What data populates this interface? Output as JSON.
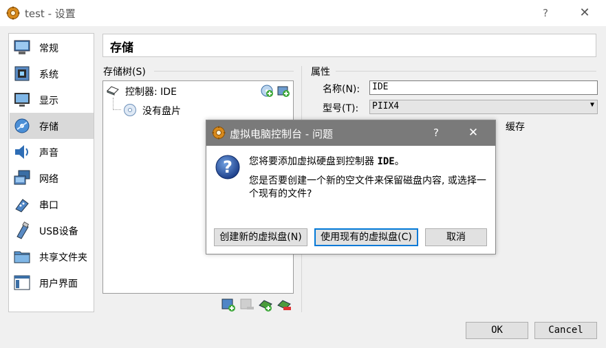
{
  "window": {
    "title": "test - 设置",
    "help_glyph": "?",
    "close_glyph": "✕"
  },
  "nav": {
    "items": [
      {
        "label": "常规",
        "icon": "general-icon"
      },
      {
        "label": "系统",
        "icon": "system-icon"
      },
      {
        "label": "显示",
        "icon": "display-icon"
      },
      {
        "label": "存储",
        "icon": "storage-icon",
        "selected": true
      },
      {
        "label": "声音",
        "icon": "audio-icon"
      },
      {
        "label": "网络",
        "icon": "network-icon"
      },
      {
        "label": "串口",
        "icon": "serial-port-icon"
      },
      {
        "label": "USB设备",
        "icon": "usb-icon"
      },
      {
        "label": "共享文件夹",
        "icon": "shared-folder-icon"
      },
      {
        "label": "用户界面",
        "icon": "user-interface-icon"
      }
    ]
  },
  "page": {
    "title": "存储"
  },
  "storage_tree": {
    "label": "存储树(S)",
    "controller_label": "控制器: IDE",
    "empty_disk_label": "没有盘片"
  },
  "attributes": {
    "label": "属性",
    "name_label": "名称(N):",
    "name_value": "IDE",
    "type_label": "型号(T):",
    "type_value": "PIIX4",
    "cache_label": "缓存"
  },
  "buttons": {
    "ok": "OK",
    "cancel": "Cancel"
  },
  "dialog": {
    "title": "虚拟电脑控制台 - 问题",
    "help_glyph": "?",
    "close_glyph": "✕",
    "message_prefix": "您将要添加虚拟硬盘到控制器 ",
    "message_controller": "IDE",
    "message_suffix": "。",
    "question": "您是否要创建一个新的空文件来保留磁盘内容, 或选择一个现有的文件?",
    "create_button": "创建新的虚拟盘(N)",
    "existing_button": "使用现有的虚拟盘(C)",
    "cancel_button": "取消"
  },
  "colors": {
    "dialog_titlebar": "#7a7a7a",
    "selected_nav": "#d9d9d9",
    "focus_border": "#0078d7"
  }
}
